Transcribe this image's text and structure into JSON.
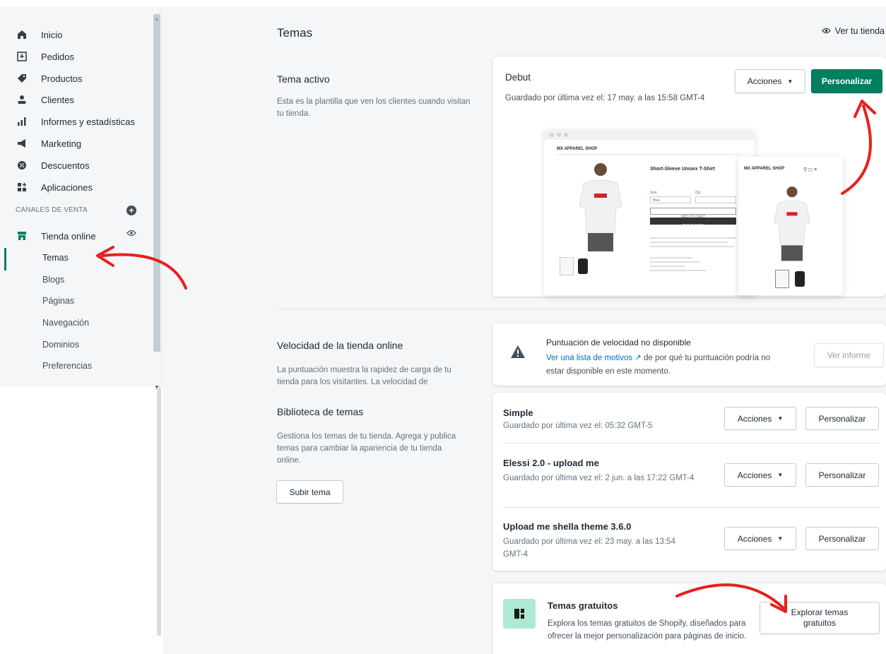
{
  "nav": {
    "items": [
      {
        "label": "Inicio",
        "icon": "home-icon"
      },
      {
        "label": "Pedidos",
        "icon": "orders-icon"
      },
      {
        "label": "Productos",
        "icon": "tag-icon"
      },
      {
        "label": "Clientes",
        "icon": "person-icon"
      },
      {
        "label": "Informes y estadísticas",
        "icon": "bar-chart-icon"
      },
      {
        "label": "Marketing",
        "icon": "megaphone-icon"
      },
      {
        "label": "Descuentos",
        "icon": "discount-icon"
      },
      {
        "label": "Aplicaciones",
        "icon": "apps-icon"
      }
    ],
    "sales_channels_label": "CANALES DE VENTA",
    "online_store": "Tienda online",
    "sub_items": [
      "Temas",
      "Blogs",
      "Páginas",
      "Navegación",
      "Dominios",
      "Preferencias"
    ]
  },
  "header": {
    "title": "Temas",
    "view_store": "Ver tu tienda"
  },
  "active_theme": {
    "section_title": "Tema activo",
    "section_desc": "Esta es la plantilla que ven los clientes cuando visitan tu tienda.",
    "name": "Debut",
    "saved": "Guardado por última vez el: 17 may. a las 15:58 GMT-4",
    "actions_label": "Acciones",
    "customize_label": "Personalizar",
    "preview": {
      "store_name": "MX APPAREL SHOP",
      "mobile_store_name": "MX APPAREL SHOP",
      "product_title": "Short-Sleeve Unisex T-Shirt",
      "size_label": "Size",
      "qty_label": "Qty",
      "size_value": "Blue",
      "add_to_cart": "ADD TO CART",
      "buy_now": "BUY IT NOW",
      "shirt_print": "BRAND"
    }
  },
  "speed": {
    "section_title": "Velocidad de la tienda online",
    "section_desc": "La puntuación muestra la rapidez de carga de tu tienda para los visitantes. La velocidad de",
    "heading": "Puntuación de velocidad no disponible",
    "link": "Ver una lista de motivos",
    "text_after_link": "de por qué tu puntuación podría no estar disponible en este momento.",
    "report_button": "Ver informe"
  },
  "library": {
    "section_title": "Biblioteca de temas",
    "section_desc": "Gestiona los temas de tu tienda. Agrega y publica temas para cambiar la apariencia de tu tienda online.",
    "upload_button": "Subir tema",
    "themes": [
      {
        "name": "Simple",
        "saved": "Guardado por última vez el: 05:32 GMT-5"
      },
      {
        "name": "Elessi 2.0 - upload me",
        "saved": "Guardado por última vez el: 2 jun. a las 17:22 GMT-4"
      },
      {
        "name": "Upload me shella theme 3.6.0",
        "saved": "Guardado por última vez el: 23 may. a las 13:54 GMT-4"
      }
    ],
    "actions_label": "Acciones",
    "customize_label": "Personalizar"
  },
  "free_themes": {
    "title": "Temas gratuitos",
    "desc": "Explora los temas gratuitos de Shopify, diseñados para ofrecer la mejor personalización para páginas de inicio.",
    "button": "Explorar temas gratuitos"
  },
  "colors": {
    "primary": "#008060",
    "annotation_arrow": "#e8201a",
    "link": "#006fbb"
  }
}
